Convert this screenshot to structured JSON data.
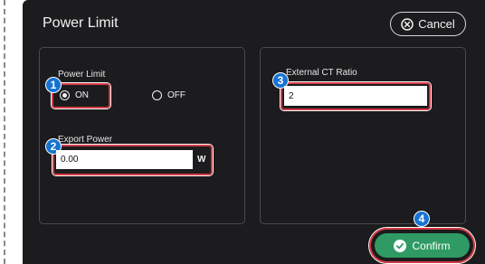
{
  "dialog": {
    "title": "Power Limit",
    "cancel_label": "Cancel",
    "confirm_label": "Confirm"
  },
  "power_limit": {
    "label": "Power Limit",
    "option_on": "ON",
    "option_off": "OFF",
    "selected": "ON"
  },
  "export_power": {
    "label": "Export Power",
    "value": "0.00",
    "unit": "W"
  },
  "ct_ratio": {
    "label": "External CT Ratio",
    "value": "2"
  },
  "badges": [
    "1",
    "2",
    "3",
    "4"
  ],
  "colors": {
    "dialog_bg": "#1c1c1e",
    "highlight": "#d43a45",
    "badge": "#1673d1",
    "confirm": "#2f9a63"
  },
  "icons": {
    "cancel": "circle-x-icon",
    "confirm": "circle-check-icon"
  }
}
